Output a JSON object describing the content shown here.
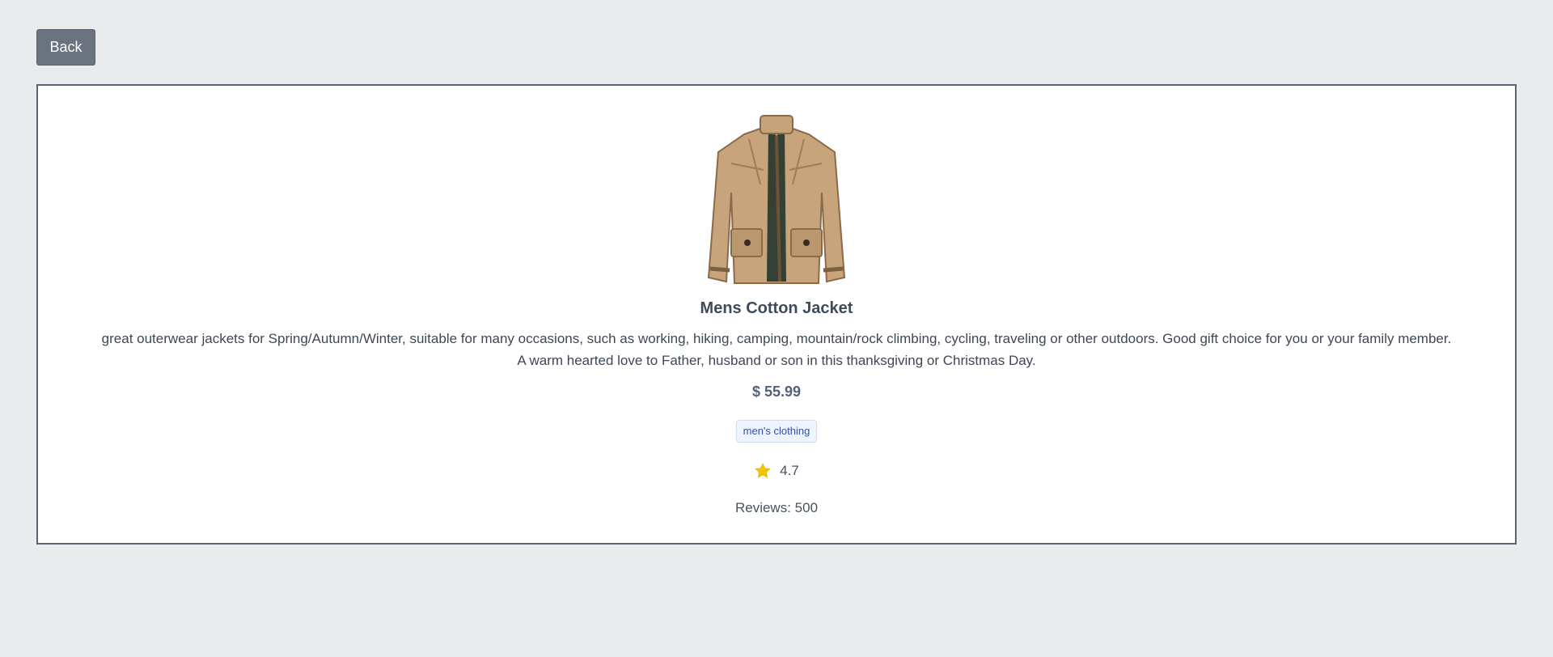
{
  "toolbar": {
    "back_label": "Back"
  },
  "product": {
    "image_icon": "jacket-icon",
    "title": "Mens Cotton Jacket",
    "description_line1": "great outerwear jackets for Spring/Autumn/Winter, suitable for many occasions, such as working, hiking, camping, mountain/rock climbing, cycling, traveling or other outdoors. Good gift choice for you or your family member.",
    "description_line2": "A warm hearted love to Father, husband or son in this thanksgiving or Christmas Day.",
    "price": "$ 55.99",
    "category": "men's clothing",
    "rating": "4.7",
    "rating_icon": "star-icon",
    "reviews": "Reviews: 500"
  },
  "colors": {
    "page_background": "#e8ecee",
    "button": "#6b7280",
    "badge_text": "#3450a8",
    "star": "#f4c400"
  }
}
